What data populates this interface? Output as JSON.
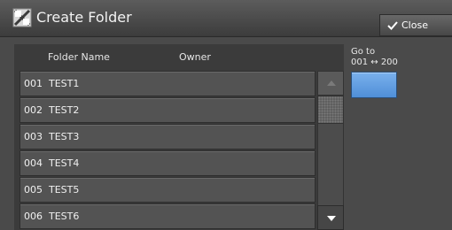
{
  "window": {
    "title": "Create Folder",
    "title_icon": "folder-create-icon"
  },
  "toolbar": {
    "close_label": "Close",
    "close_icon": "checkmark-icon"
  },
  "list": {
    "headers": {
      "folder_name": "Folder Name",
      "owner": "Owner"
    },
    "rows": [
      {
        "label": "001  TEST1"
      },
      {
        "label": "002  TEST2"
      },
      {
        "label": "003  TEST3"
      },
      {
        "label": "004  TEST4"
      },
      {
        "label": "005  TEST5"
      },
      {
        "label": "006  TEST6"
      }
    ]
  },
  "goto": {
    "label_line1": "Go to",
    "label_line2": "001 ↔ 200"
  },
  "colors": {
    "accent_button": "#5b9be2",
    "background": "#4a4a4a",
    "row_background": "#535353"
  }
}
